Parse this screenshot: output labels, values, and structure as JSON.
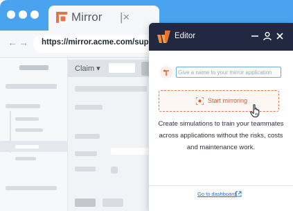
{
  "browser": {
    "tab": {
      "title": "Mirror",
      "close_glyph": "|×",
      "logo_icon": "mirror-logo-icon"
    },
    "nav": {
      "back_glyph": "←",
      "forward_glyph": "→"
    },
    "url": "https://mirror.acme.com/suppo"
  },
  "app": {
    "filter_label": "Claim ▾"
  },
  "editor": {
    "title": "Editor",
    "header_icons": [
      "minimize-icon",
      "user-icon",
      "close-icon"
    ],
    "name_placeholder": "Give a name to your mirror application",
    "start_label": "Start mirroring",
    "description": "Create simulations to train your teammates across applications without the risks, costs and maintenance work.",
    "dashboard_link": "Go to dashboard"
  },
  "colors": {
    "titlebar": "#4aa3ef",
    "editor_header": "#222841",
    "accent_orange": "#e37652",
    "link_blue": "#2a6fc4"
  }
}
